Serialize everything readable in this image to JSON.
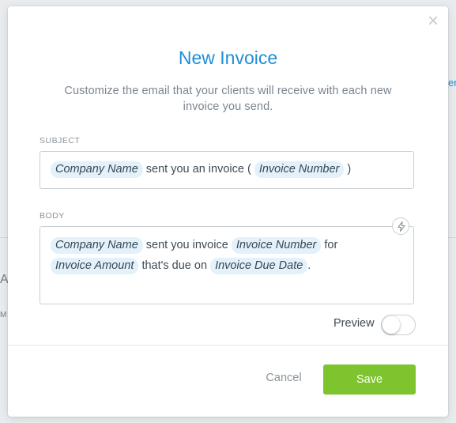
{
  "modal": {
    "title": "New Invoice",
    "subtitle": "Customize the email that your clients will receive with each new invoice you send.",
    "close_icon": "×",
    "subject": {
      "label": "SUBJECT",
      "tokens": [
        "Company Name",
        "Invoice Number"
      ],
      "text": [
        "sent you an invoice (",
        ")"
      ]
    },
    "body": {
      "label": "BODY",
      "tokens": [
        "Company Name",
        "Invoice Number",
        "Invoice Amount",
        "Invoice Due Date"
      ],
      "text": [
        "sent you invoice",
        "for",
        "that's due on",
        "."
      ]
    },
    "preview": {
      "label": "Preview",
      "enabled": false
    },
    "buttons": {
      "cancel": "Cancel",
      "save": "Save"
    },
    "colors": {
      "accent": "#1e8fd8",
      "save": "#7dc42e",
      "token_bg": "#e3f1fb"
    }
  },
  "background": {
    "fragments": [
      "en",
      "Ac",
      "M"
    ]
  }
}
